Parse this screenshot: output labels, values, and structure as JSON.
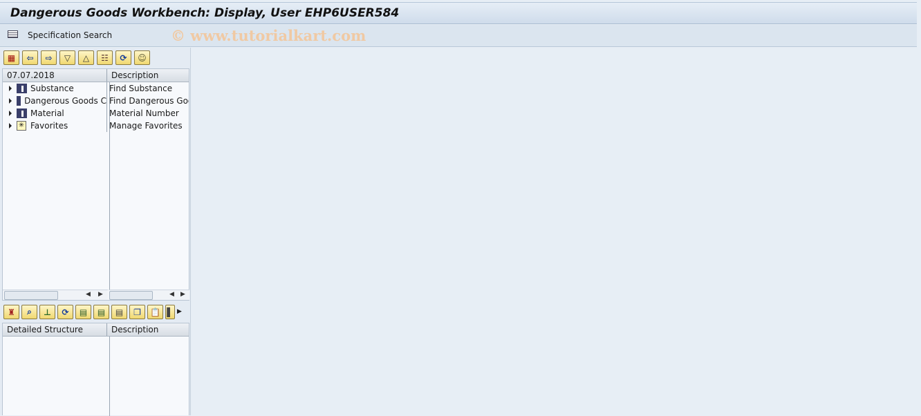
{
  "window": {
    "title": "Dangerous Goods Workbench: Display, User EHP6USER584"
  },
  "appbar": {
    "specification_search": "Specification Search",
    "watermark": "© www.tutorialkart.com"
  },
  "top_toolbar": [
    "calendar-icon",
    "arrow-left-icon",
    "arrow-right-icon",
    "expand-icon",
    "collapse-icon",
    "detail-icon",
    "refresh-icon",
    "users-icon"
  ],
  "tree": {
    "header": {
      "col1": "07.07.2018",
      "col2": "Description"
    },
    "rows": [
      {
        "label": "Substance",
        "description": "Find Substance",
        "icon": "binoculars-icon"
      },
      {
        "label": "Dangerous Goods C",
        "description": "Find Dangerous Good",
        "icon": "binoculars-icon"
      },
      {
        "label": "Material",
        "description": "Material Number",
        "icon": "binoculars-icon"
      },
      {
        "label": "Favorites",
        "description": "Manage Favorites",
        "icon": "favorites-icon"
      }
    ]
  },
  "bottom_toolbar": [
    "hat-icon",
    "search-icon",
    "hierarchy-icon",
    "refresh-icon",
    "list-edit-icon",
    "list-edit2-icon",
    "document-icon",
    "copy-icon",
    "paste-icon",
    "more-icon"
  ],
  "structure": {
    "header": {
      "col1": "Detailed Structure",
      "col2": "Description"
    }
  }
}
